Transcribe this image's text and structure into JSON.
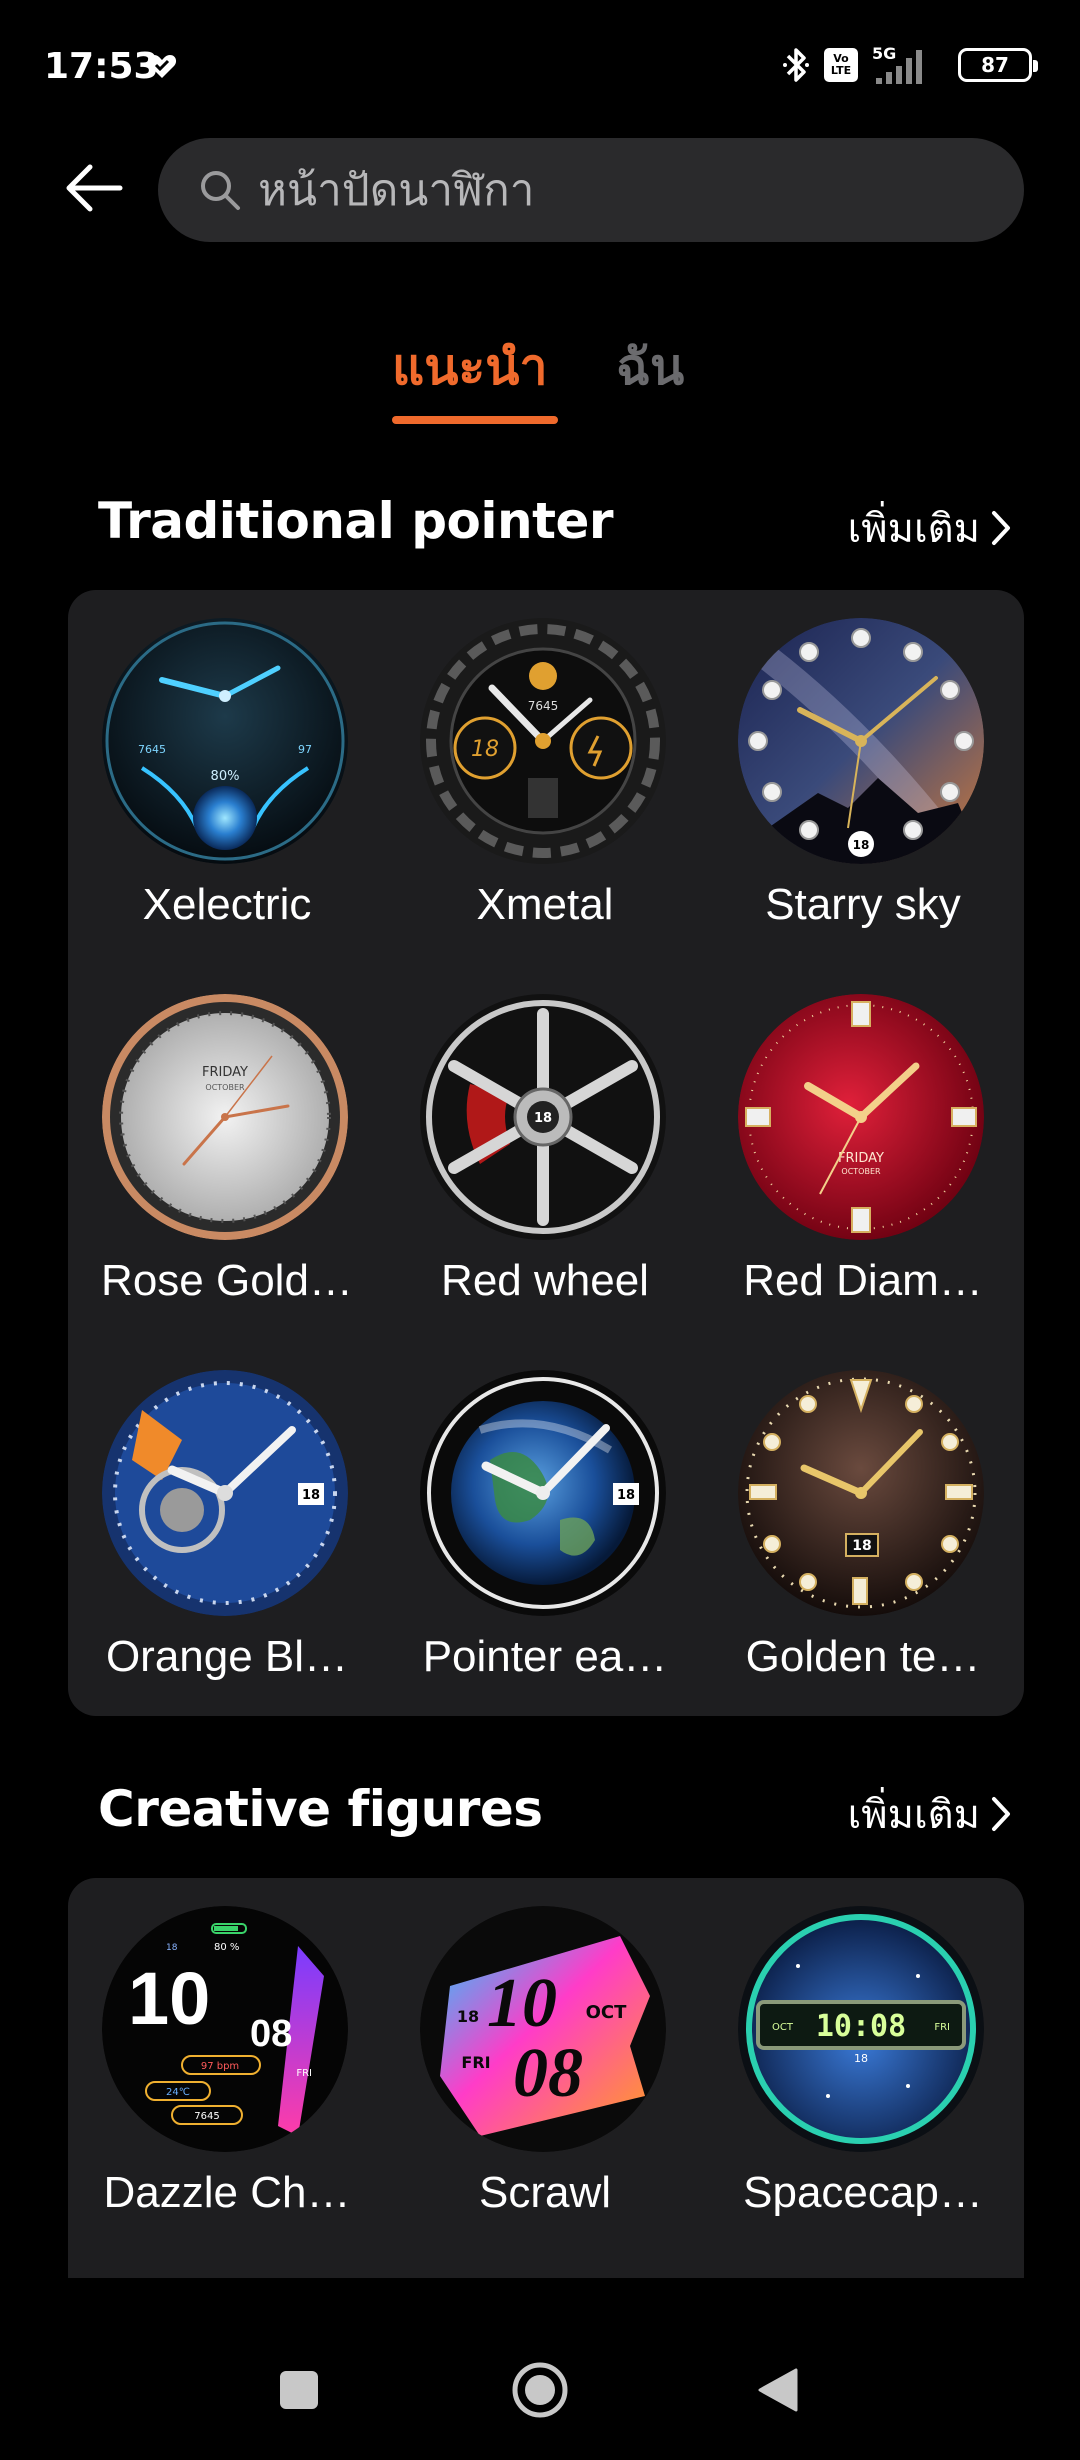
{
  "status_bar": {
    "time": "17:53",
    "network": "5G",
    "volte_top": "Vo",
    "volte_bottom": "LTE",
    "battery": "87"
  },
  "search": {
    "placeholder": "หน้าปัดนาฬิกา"
  },
  "tabs": [
    {
      "label": "แนะนำ",
      "active": true
    },
    {
      "label": "ฉัน",
      "active": false
    }
  ],
  "accent_color": "#f06a2c",
  "sections": [
    {
      "title": "Traditional pointer",
      "more_label": "เพิ่มเติม",
      "items": [
        {
          "label": "Xelectric"
        },
        {
          "label": "Xmetal"
        },
        {
          "label": "Starry sky"
        },
        {
          "label": "Rose Gold…"
        },
        {
          "label": "Red wheel"
        },
        {
          "label": "Red Diam…"
        },
        {
          "label": "Orange Bl…"
        },
        {
          "label": "Pointer ea…"
        },
        {
          "label": "Golden te…"
        }
      ]
    },
    {
      "title": "Creative figures",
      "more_label": "เพิ่มเติม",
      "items": [
        {
          "label": "Dazzle Ch…"
        },
        {
          "label": "Scrawl"
        },
        {
          "label": "Spacecap…"
        }
      ]
    }
  ],
  "face_text": {
    "xelectric_steps": "7645",
    "xelectric_pct": "80%",
    "xelectric_hr": "97",
    "xmetal_steps": "7645",
    "xmetal_date": "18",
    "starry_date": "18",
    "rose_day": "FRIDAY",
    "rose_month": "OCTOBER",
    "wheel_date": "18",
    "diamond_day": "FRIDAY",
    "diamond_month": "OCTOBER",
    "orange_date": "18",
    "earth_date": "18",
    "golden_date": "18",
    "dazzle_hour": "10",
    "dazzle_min": "08",
    "dazzle_day": "FRI",
    "dazzle_date": "18",
    "dazzle_pct": "80 %",
    "dazzle_bpm": "97 bpm",
    "dazzle_temp": "24℃",
    "dazzle_steps": "7645",
    "scrawl_hour": "10",
    "scrawl_min": "08",
    "scrawl_month": "OCT",
    "scrawl_day": "FRI",
    "scrawl_date": "18",
    "space_time": "10:08",
    "space_month": "OCT",
    "space_day": "FRI",
    "space_date": "18"
  }
}
